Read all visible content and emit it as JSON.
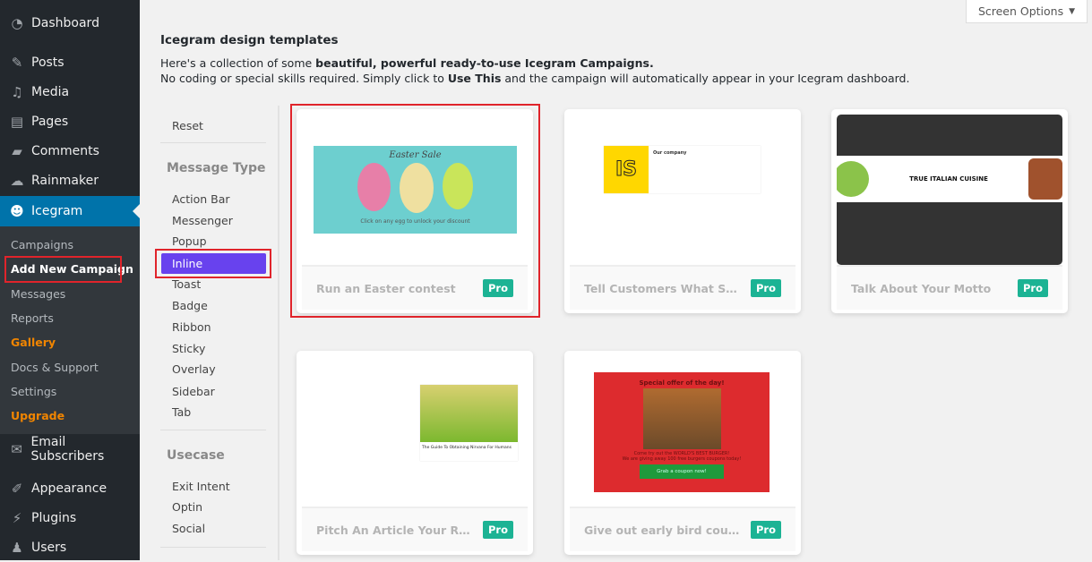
{
  "sidebar": {
    "items": [
      {
        "label": "Dashboard",
        "icon": "dashboard-icon"
      },
      {
        "label": "Posts",
        "icon": "pin-icon"
      },
      {
        "label": "Media",
        "icon": "media-icon"
      },
      {
        "label": "Pages",
        "icon": "pages-icon"
      },
      {
        "label": "Comments",
        "icon": "comment-icon"
      },
      {
        "label": "Rainmaker",
        "icon": "cloud-icon"
      },
      {
        "label": "Icegram",
        "icon": "icegram-icon"
      },
      {
        "label": "Email Subscribers",
        "icon": "mail-icon"
      },
      {
        "label": "Appearance",
        "icon": "brush-icon"
      },
      {
        "label": "Plugins",
        "icon": "plug-icon"
      },
      {
        "label": "Users",
        "icon": "user-icon"
      }
    ],
    "submenu": [
      "Campaigns",
      "Add New Campaign",
      "Messages",
      "Reports",
      "Gallery",
      "Docs & Support",
      "Settings",
      "Upgrade"
    ]
  },
  "screen_options": "Screen Options",
  "header": {
    "title": "Icegram design templates",
    "desc1_pre": "Here's a collection of some ",
    "desc1_bold": "beautiful, powerful ready-to-use Icegram Campaigns.",
    "desc2_pre": "No coding or special skills required. Simply click to ",
    "desc2_bold": "Use This",
    "desc2_post": " and the campaign will automatically appear in your Icegram dashboard."
  },
  "filters": {
    "reset": "Reset",
    "message_type_heading": "Message Type",
    "message_types": [
      "Action Bar",
      "Messenger",
      "Popup",
      "Inline",
      "Toast",
      "Badge",
      "Ribbon",
      "Sticky",
      "Overlay",
      "Sidebar",
      "Tab"
    ],
    "selected": "Inline",
    "usecase_heading": "Usecase",
    "usecases": [
      "Exit Intent",
      "Optin",
      "Social"
    ]
  },
  "cards": [
    {
      "title": "Run an Easter contest",
      "badge": "Pro",
      "preview": {
        "heading": "Easter Sale",
        "caption": "Click on any egg to unlock your discount"
      }
    },
    {
      "title": "Tell Customers What Serv...",
      "badge": "Pro",
      "preview": {
        "heading": "Our company",
        "logo": "IS"
      }
    },
    {
      "title": "Talk About Your Motto",
      "badge": "Pro",
      "preview": {
        "heading": "TRUE ITALIAN CUISINE"
      }
    },
    {
      "title": "Pitch An Article Your Rea...",
      "badge": "Pro",
      "preview": {
        "caption": "The Guide To Obtaining Nirvana For Humans"
      }
    },
    {
      "title": "Give out early bird coupons",
      "badge": "Pro",
      "preview": {
        "heading": "Special offer of the day!",
        "line1": "Come try out the WORLD'S BEST BURGER!",
        "line2": "We are giving away 100 free burgers coupons today!",
        "button": "Grab a coupon now!"
      }
    }
  ],
  "colors": {
    "accent": "#6842ee",
    "pro": "#1cb394",
    "wp_blue": "#0073aa",
    "highlight": "#e0242b"
  }
}
